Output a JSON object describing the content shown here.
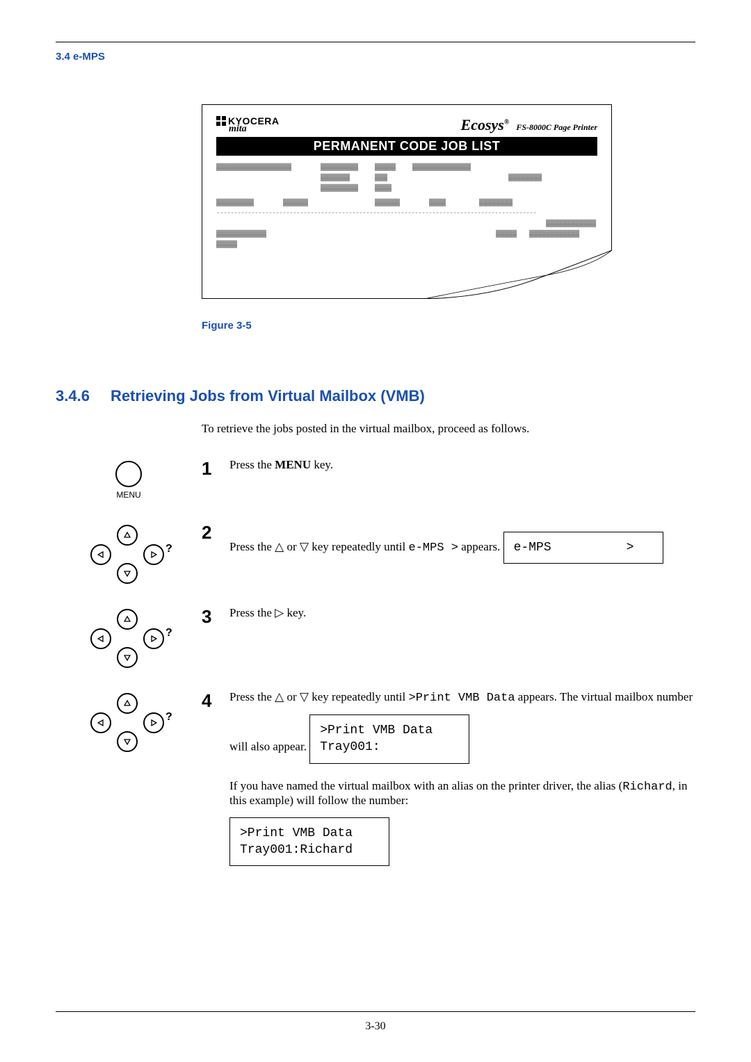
{
  "header": {
    "section_link": "3.4 e-MPS"
  },
  "figure": {
    "kyocera_label": "KYOCERA",
    "mita_label": "mita",
    "ecosys": "Ecosys",
    "ecosys_mark": "®",
    "printer_model": "FS-8000C  Page Printer",
    "bar_title": "PERMANENT CODE JOB LIST",
    "caption": "Figure 3-5"
  },
  "section": {
    "number": "3.4.6",
    "title": "Retrieving Jobs from Virtual Mailbox (VMB)"
  },
  "intro": "To retrieve the jobs posted in the virtual mailbox, proceed as follows.",
  "steps": {
    "s1": {
      "num": "1",
      "pre": "Press the ",
      "bold": "MENU",
      "post": " key.",
      "menu_label": "MENU"
    },
    "s2": {
      "num": "2",
      "pre": "Press the ",
      "mid": " or ",
      "post1": " key repeatedly until ",
      "mono": "e-MPS  >",
      "post2": " appears.",
      "lcd": "e-MPS          >"
    },
    "s3": {
      "num": "3",
      "pre": "Press the ",
      "post": " key."
    },
    "s4": {
      "num": "4",
      "pre": "Press the ",
      "mid": " or ",
      "post1": " key repeatedly until ",
      "mono": ">Print  VMB  Data",
      "post2": " appears. The virtual mailbox number will also appear.",
      "lcd1": ">Print VMB Data\nTray001:",
      "follow_pre": "If you have named the virtual mailbox with an alias on the printer driver, the alias (",
      "follow_mono": "Richard",
      "follow_post": ", in this example) will follow the number:",
      "lcd2": ">Print VMB Data\nTray001:Richard"
    }
  },
  "page_number": "3-30"
}
